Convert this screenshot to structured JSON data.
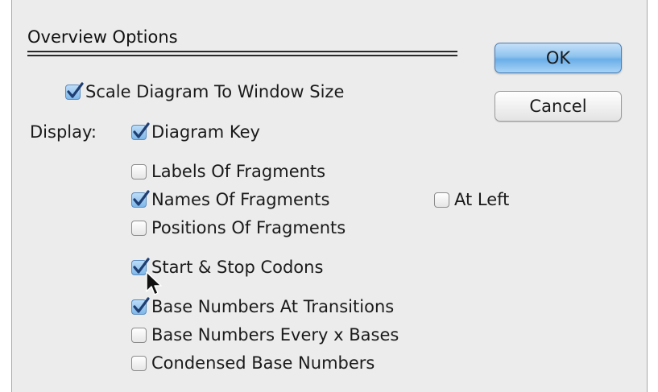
{
  "dialog": {
    "section_title": "Overview Options",
    "ok_label": "OK",
    "cancel_label": "Cancel",
    "display_label": "Display:"
  },
  "options": {
    "scale_to_window": {
      "label": "Scale Diagram To Window Size",
      "checked": true
    },
    "diagram_key": {
      "label": "Diagram Key",
      "checked": true
    },
    "labels_of_fragments": {
      "label": "Labels Of Fragments",
      "checked": false
    },
    "names_of_fragments": {
      "label": "Names Of Fragments",
      "checked": true
    },
    "at_left": {
      "label": "At Left",
      "checked": false
    },
    "positions_of_fragments": {
      "label": "Positions Of Fragments",
      "checked": false
    },
    "start_stop_codons": {
      "label": "Start & Stop Codons",
      "checked": true
    },
    "base_numbers_transitions": {
      "label": "Base Numbers At Transitions",
      "checked": true
    },
    "base_numbers_every_x": {
      "label": "Base Numbers Every x Bases",
      "checked": false
    },
    "condensed_base_numbers": {
      "label": "Condensed Base Numbers",
      "checked": false
    }
  },
  "colors": {
    "ok_button": "#8ec3ef",
    "checkmark": "#1f3f73",
    "dialog_bg": "#ececec"
  }
}
